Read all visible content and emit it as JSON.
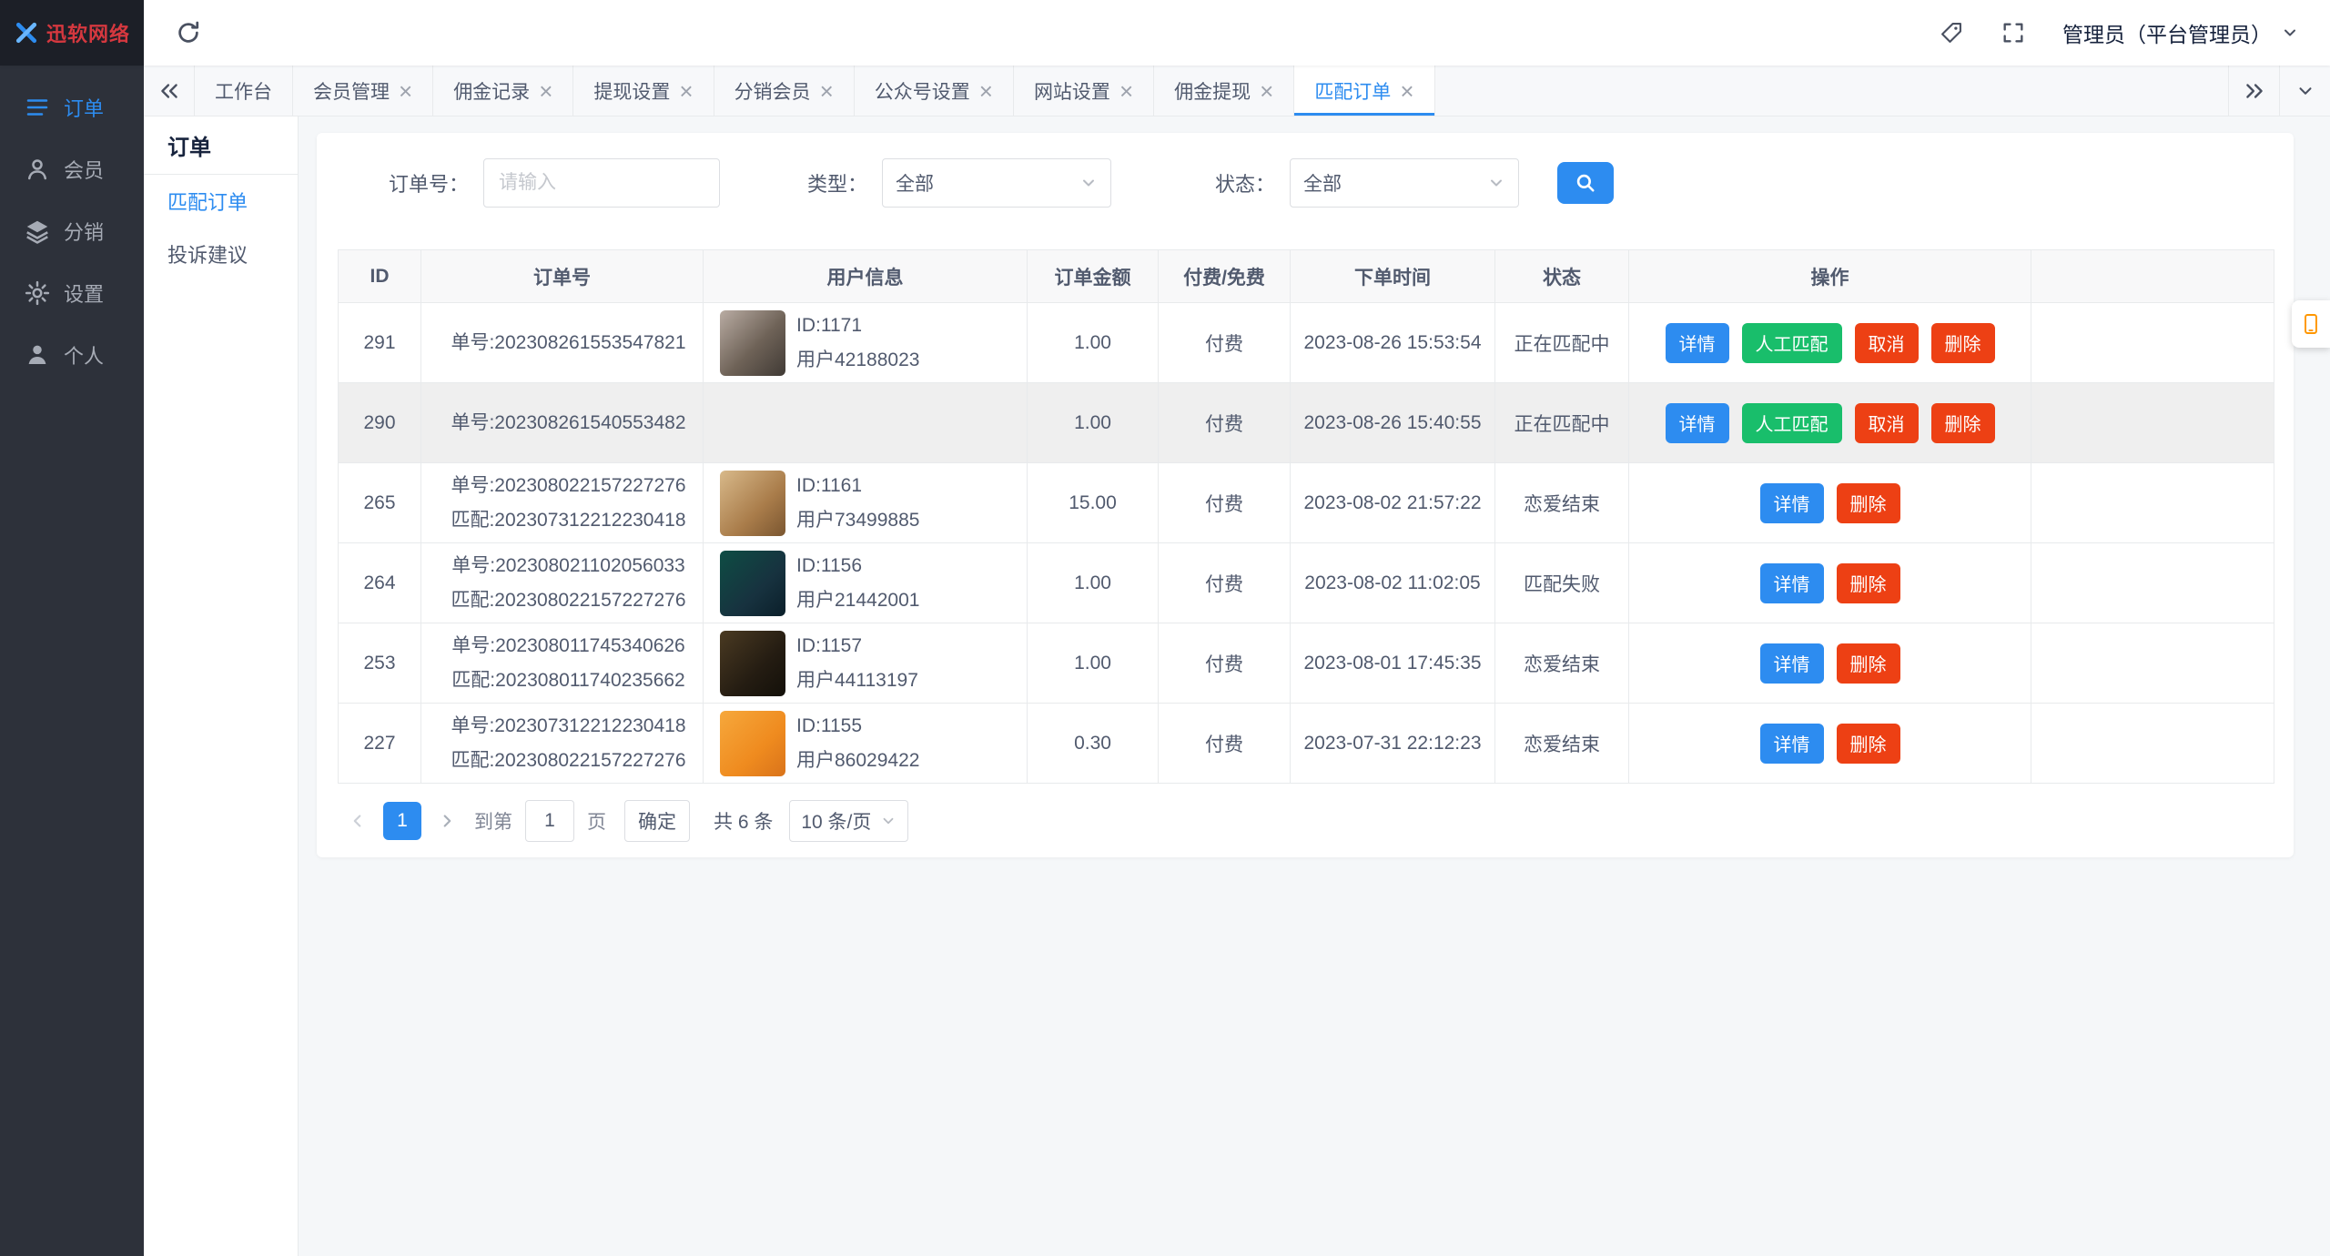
{
  "topbar": {
    "brand": "迅软网络",
    "user_label": "管理员（平台管理员）"
  },
  "sidebar": {
    "items": [
      {
        "key": "orders",
        "label": "订单",
        "icon": "order-list-icon",
        "active": true
      },
      {
        "key": "members",
        "label": "会员",
        "icon": "member-icon",
        "active": false
      },
      {
        "key": "distribution",
        "label": "分销",
        "icon": "distribution-icon",
        "active": false
      },
      {
        "key": "settings",
        "label": "设置",
        "icon": "settings-gear-icon",
        "active": false
      },
      {
        "key": "profile",
        "label": "个人",
        "icon": "profile-icon",
        "active": false
      }
    ]
  },
  "tabbar": {
    "tabs": [
      {
        "key": "workbench",
        "label": "工作台",
        "closable": false,
        "active": false
      },
      {
        "key": "member-management",
        "label": "会员管理",
        "closable": true,
        "active": false
      },
      {
        "key": "commission-records",
        "label": "佣金记录",
        "closable": true,
        "active": false
      },
      {
        "key": "withdraw-settings",
        "label": "提现设置",
        "closable": true,
        "active": false
      },
      {
        "key": "distribution-members",
        "label": "分销会员",
        "closable": true,
        "active": false
      },
      {
        "key": "official-account-settings",
        "label": "公众号设置",
        "closable": true,
        "active": false
      },
      {
        "key": "site-settings",
        "label": "网站设置",
        "closable": true,
        "active": false
      },
      {
        "key": "commission-withdraw",
        "label": "佣金提现",
        "closable": true,
        "active": false
      },
      {
        "key": "match-orders",
        "label": "匹配订单",
        "closable": true,
        "active": true
      }
    ]
  },
  "submenu": {
    "title": "订单",
    "items": [
      {
        "key": "match-orders",
        "label": "匹配订单",
        "active": true
      },
      {
        "key": "complaints",
        "label": "投诉建议",
        "active": false
      }
    ]
  },
  "filters": {
    "order_no_label": "订单号：",
    "order_no_placeholder": "请输入",
    "type_label": "类型：",
    "type_value": "全部",
    "status_label": "状态：",
    "status_value": "全部"
  },
  "table": {
    "headers": [
      "ID",
      "订单号",
      "用户信息",
      "订单金额",
      "付费/免费",
      "下单时间",
      "状态",
      "操作"
    ],
    "rows": [
      {
        "id": "291",
        "order_lines": [
          "单号:202308261553547821"
        ],
        "avatar": "portrait",
        "user_id": "ID:1171",
        "user_name": "用户42188023",
        "amount": "1.00",
        "fee_type": "付费",
        "time": "2023-08-26 15:53:54",
        "status": "正在匹配中",
        "status_type": "danger",
        "highlighted": false,
        "actions": [
          {
            "name": "detail",
            "label": "详情",
            "type": "primary"
          },
          {
            "name": "manual-match",
            "label": "人工匹配",
            "type": "success"
          },
          {
            "name": "cancel",
            "label": "取消",
            "type": "danger"
          },
          {
            "name": "delete",
            "label": "删除",
            "type": "danger"
          }
        ]
      },
      {
        "id": "290",
        "order_lines": [
          "单号:202308261540553482"
        ],
        "avatar": "none",
        "user_id": "",
        "user_name": "",
        "amount": "1.00",
        "fee_type": "付费",
        "time": "2023-08-26 15:40:55",
        "status": "正在匹配中",
        "status_type": "danger",
        "highlighted": true,
        "actions": [
          {
            "name": "detail",
            "label": "详情",
            "type": "primary"
          },
          {
            "name": "manual-match",
            "label": "人工匹配",
            "type": "success"
          },
          {
            "name": "cancel",
            "label": "取消",
            "type": "danger"
          },
          {
            "name": "delete",
            "label": "删除",
            "type": "danger"
          }
        ]
      },
      {
        "id": "265",
        "order_lines": [
          "单号:202308022157227276",
          "匹配:202307312212230418"
        ],
        "avatar": "dog",
        "user_id": "ID:1161",
        "user_name": "用户73499885",
        "amount": "15.00",
        "fee_type": "付费",
        "time": "2023-08-02 21:57:22",
        "status": "恋爱结束",
        "status_type": "muted",
        "highlighted": false,
        "actions": [
          {
            "name": "detail",
            "label": "详情",
            "type": "primary"
          },
          {
            "name": "delete",
            "label": "删除",
            "type": "danger"
          }
        ]
      },
      {
        "id": "264",
        "order_lines": [
          "单号:202308021102056033",
          "匹配:202308022157227276"
        ],
        "avatar": "screen",
        "user_id": "ID:1156",
        "user_name": "用户21442001",
        "amount": "1.00",
        "fee_type": "付费",
        "time": "2023-08-02 11:02:05",
        "status": "匹配失败",
        "status_type": "muted",
        "highlighted": false,
        "actions": [
          {
            "name": "detail",
            "label": "详情",
            "type": "primary"
          },
          {
            "name": "delete",
            "label": "删除",
            "type": "danger"
          }
        ]
      },
      {
        "id": "253",
        "order_lines": [
          "单号:202308011745340626",
          "匹配:202308011740235662"
        ],
        "avatar": "game",
        "user_id": "ID:1157",
        "user_name": "用户44113197",
        "amount": "1.00",
        "fee_type": "付费",
        "time": "2023-08-01 17:45:35",
        "status": "恋爱结束",
        "status_type": "muted",
        "highlighted": false,
        "actions": [
          {
            "name": "detail",
            "label": "详情",
            "type": "primary"
          },
          {
            "name": "delete",
            "label": "删除",
            "type": "danger"
          }
        ]
      },
      {
        "id": "227",
        "order_lines": [
          "单号:202307312212230418",
          "匹配:202308022157227276"
        ],
        "avatar": "cartoon",
        "user_id": "ID:1155",
        "user_name": "用户86029422",
        "amount": "0.30",
        "fee_type": "付费",
        "time": "2023-07-31 22:12:23",
        "status": "恋爱结束",
        "status_type": "muted",
        "highlighted": false,
        "actions": [
          {
            "name": "detail",
            "label": "详情",
            "type": "primary"
          },
          {
            "name": "delete",
            "label": "删除",
            "type": "danger"
          }
        ]
      }
    ]
  },
  "pagination": {
    "current_page": "1",
    "goto_label": "到第",
    "goto_value": "1",
    "page_unit": "页",
    "confirm_label": "确定",
    "total_label": "共 6 条",
    "page_size_label": "10 条/页"
  },
  "colors": {
    "primary": "#2d8cf0",
    "success": "#19be6b",
    "danger": "#ed4014",
    "brand_red": "#d5383f",
    "sidebar_bg": "#2d313a",
    "muted_status": "#808695"
  }
}
